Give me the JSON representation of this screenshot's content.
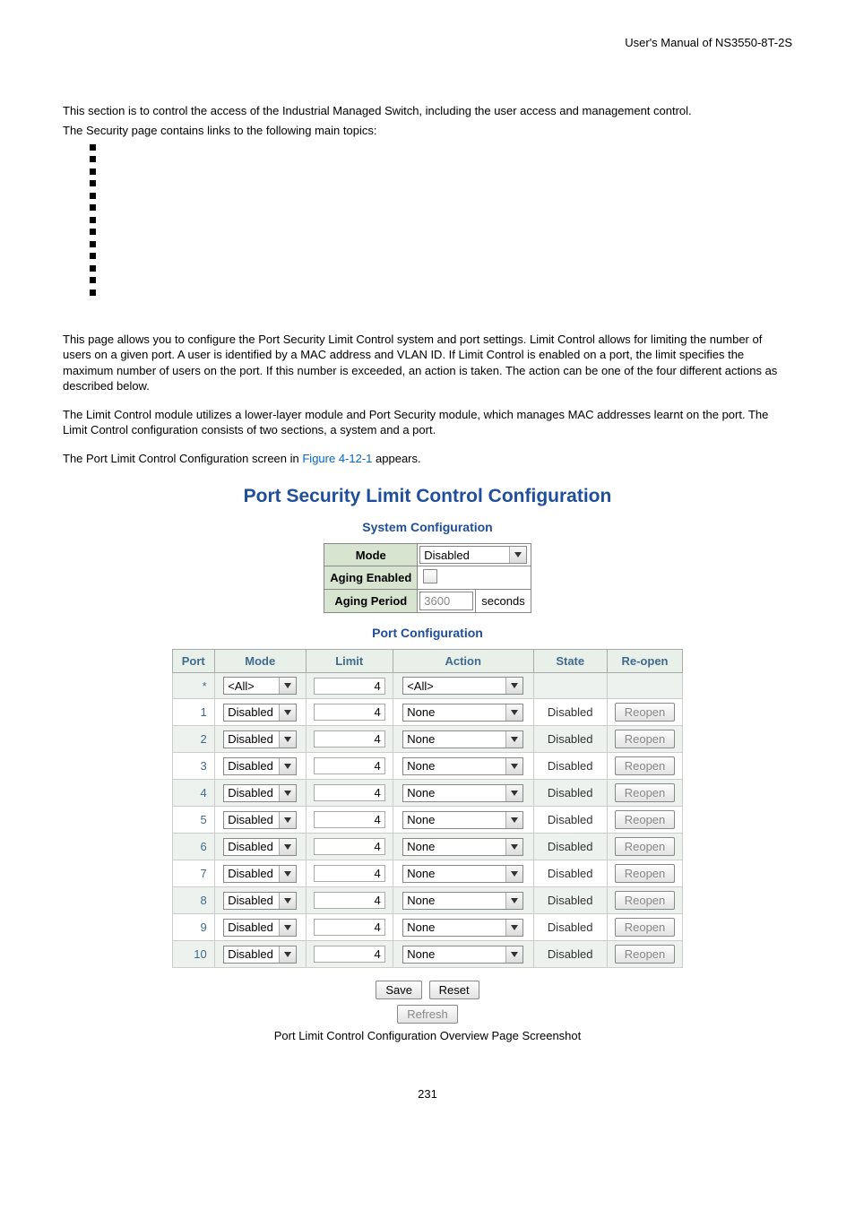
{
  "header": "User's Manual of NS3550-8T-2S",
  "intro1": "This section is to control the access of the Industrial Managed Switch, including the user access and management control.",
  "intro2": "The Security page contains links to the following main topics:",
  "para1": "This page allows you to configure the Port Security Limit Control system and port settings. Limit Control allows for limiting the number of users on a given port. A user is identified by a MAC address and VLAN ID. If Limit Control is enabled on a port, the limit specifies the maximum number of users on the port. If this number is exceeded, an action is taken. The action can be one of the four different actions as described below.",
  "para2": "The Limit Control module utilizes a lower-layer module and Port Security module, which manages MAC addresses learnt on the port. The Limit Control configuration consists of two sections, a system and a port.",
  "para3_pre": "The Port Limit Control Configuration screen in ",
  "para3_fig": "Figure 4-12-1",
  "para3_post": " appears.",
  "cfg": {
    "title": "Port Security Limit Control Configuration",
    "sys_title": "System Configuration",
    "sys_rows": {
      "mode_label": "Mode",
      "mode_value": "Disabled",
      "aging_enabled_label": "Aging Enabled",
      "aging_period_label": "Aging Period",
      "aging_period_value": "3600",
      "aging_period_unit": "seconds"
    },
    "port_title": "Port Configuration",
    "port_headers": {
      "port": "Port",
      "mode": "Mode",
      "limit": "Limit",
      "action": "Action",
      "state": "State",
      "reopen": "Re-open"
    },
    "port_star": {
      "port": "*",
      "mode": "<All>",
      "limit": "4",
      "action": "<All>"
    },
    "port_rows": [
      {
        "port": "1",
        "mode": "Disabled",
        "limit": "4",
        "action": "None",
        "state": "Disabled",
        "reopen": "Reopen"
      },
      {
        "port": "2",
        "mode": "Disabled",
        "limit": "4",
        "action": "None",
        "state": "Disabled",
        "reopen": "Reopen"
      },
      {
        "port": "3",
        "mode": "Disabled",
        "limit": "4",
        "action": "None",
        "state": "Disabled",
        "reopen": "Reopen"
      },
      {
        "port": "4",
        "mode": "Disabled",
        "limit": "4",
        "action": "None",
        "state": "Disabled",
        "reopen": "Reopen"
      },
      {
        "port": "5",
        "mode": "Disabled",
        "limit": "4",
        "action": "None",
        "state": "Disabled",
        "reopen": "Reopen"
      },
      {
        "port": "6",
        "mode": "Disabled",
        "limit": "4",
        "action": "None",
        "state": "Disabled",
        "reopen": "Reopen"
      },
      {
        "port": "7",
        "mode": "Disabled",
        "limit": "4",
        "action": "None",
        "state": "Disabled",
        "reopen": "Reopen"
      },
      {
        "port": "8",
        "mode": "Disabled",
        "limit": "4",
        "action": "None",
        "state": "Disabled",
        "reopen": "Reopen"
      },
      {
        "port": "9",
        "mode": "Disabled",
        "limit": "4",
        "action": "None",
        "state": "Disabled",
        "reopen": "Reopen"
      },
      {
        "port": "10",
        "mode": "Disabled",
        "limit": "4",
        "action": "None",
        "state": "Disabled",
        "reopen": "Reopen"
      }
    ],
    "buttons": {
      "save": "Save",
      "reset": "Reset",
      "refresh": "Refresh"
    }
  },
  "caption": "Port Limit Control Configuration Overview Page Screenshot",
  "page_num": "231"
}
